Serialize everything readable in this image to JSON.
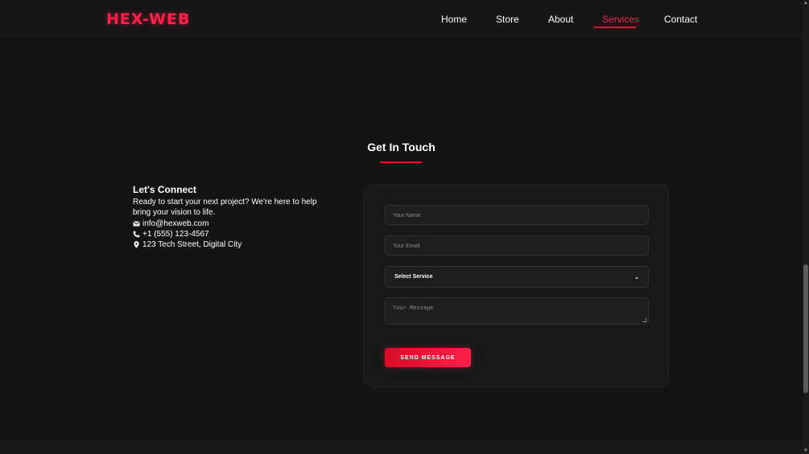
{
  "brand": {
    "logo": "HEX-WEB",
    "accent": "#ff1f4b"
  },
  "nav": {
    "items": [
      {
        "label": "Home"
      },
      {
        "label": "Store"
      },
      {
        "label": "About"
      },
      {
        "label": "Services",
        "active": true
      },
      {
        "label": "Contact"
      }
    ]
  },
  "section": {
    "title": "Get In Touch"
  },
  "info": {
    "heading": "Let's Connect",
    "description": "Ready to start your next project? We're here to help bring your vision to life.",
    "email": "info@hexweb.com",
    "phone": "+1 (555) 123-4567",
    "address": "123 Tech Street, Digital City",
    "icons": [
      "envelope-icon",
      "phone-icon",
      "map-marker-icon"
    ]
  },
  "form": {
    "name_placeholder": "Your Name",
    "email_placeholder": "Your Email",
    "service_selected": "Select Service",
    "message_placeholder": "Your Message",
    "submit_label": "SEND MESSAGE"
  }
}
